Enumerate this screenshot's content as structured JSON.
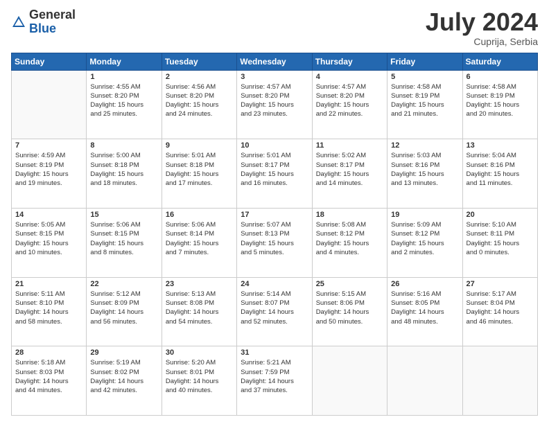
{
  "header": {
    "logo_general": "General",
    "logo_blue": "Blue",
    "month_year": "July 2024",
    "location": "Cuprija, Serbia"
  },
  "calendar": {
    "days_of_week": [
      "Sunday",
      "Monday",
      "Tuesday",
      "Wednesday",
      "Thursday",
      "Friday",
      "Saturday"
    ],
    "weeks": [
      [
        {
          "day": "",
          "info": ""
        },
        {
          "day": "1",
          "info": "Sunrise: 4:55 AM\nSunset: 8:20 PM\nDaylight: 15 hours\nand 25 minutes."
        },
        {
          "day": "2",
          "info": "Sunrise: 4:56 AM\nSunset: 8:20 PM\nDaylight: 15 hours\nand 24 minutes."
        },
        {
          "day": "3",
          "info": "Sunrise: 4:57 AM\nSunset: 8:20 PM\nDaylight: 15 hours\nand 23 minutes."
        },
        {
          "day": "4",
          "info": "Sunrise: 4:57 AM\nSunset: 8:20 PM\nDaylight: 15 hours\nand 22 minutes."
        },
        {
          "day": "5",
          "info": "Sunrise: 4:58 AM\nSunset: 8:19 PM\nDaylight: 15 hours\nand 21 minutes."
        },
        {
          "day": "6",
          "info": "Sunrise: 4:58 AM\nSunset: 8:19 PM\nDaylight: 15 hours\nand 20 minutes."
        }
      ],
      [
        {
          "day": "7",
          "info": "Sunrise: 4:59 AM\nSunset: 8:19 PM\nDaylight: 15 hours\nand 19 minutes."
        },
        {
          "day": "8",
          "info": "Sunrise: 5:00 AM\nSunset: 8:18 PM\nDaylight: 15 hours\nand 18 minutes."
        },
        {
          "day": "9",
          "info": "Sunrise: 5:01 AM\nSunset: 8:18 PM\nDaylight: 15 hours\nand 17 minutes."
        },
        {
          "day": "10",
          "info": "Sunrise: 5:01 AM\nSunset: 8:17 PM\nDaylight: 15 hours\nand 16 minutes."
        },
        {
          "day": "11",
          "info": "Sunrise: 5:02 AM\nSunset: 8:17 PM\nDaylight: 15 hours\nand 14 minutes."
        },
        {
          "day": "12",
          "info": "Sunrise: 5:03 AM\nSunset: 8:16 PM\nDaylight: 15 hours\nand 13 minutes."
        },
        {
          "day": "13",
          "info": "Sunrise: 5:04 AM\nSunset: 8:16 PM\nDaylight: 15 hours\nand 11 minutes."
        }
      ],
      [
        {
          "day": "14",
          "info": "Sunrise: 5:05 AM\nSunset: 8:15 PM\nDaylight: 15 hours\nand 10 minutes."
        },
        {
          "day": "15",
          "info": "Sunrise: 5:06 AM\nSunset: 8:15 PM\nDaylight: 15 hours\nand 8 minutes."
        },
        {
          "day": "16",
          "info": "Sunrise: 5:06 AM\nSunset: 8:14 PM\nDaylight: 15 hours\nand 7 minutes."
        },
        {
          "day": "17",
          "info": "Sunrise: 5:07 AM\nSunset: 8:13 PM\nDaylight: 15 hours\nand 5 minutes."
        },
        {
          "day": "18",
          "info": "Sunrise: 5:08 AM\nSunset: 8:12 PM\nDaylight: 15 hours\nand 4 minutes."
        },
        {
          "day": "19",
          "info": "Sunrise: 5:09 AM\nSunset: 8:12 PM\nDaylight: 15 hours\nand 2 minutes."
        },
        {
          "day": "20",
          "info": "Sunrise: 5:10 AM\nSunset: 8:11 PM\nDaylight: 15 hours\nand 0 minutes."
        }
      ],
      [
        {
          "day": "21",
          "info": "Sunrise: 5:11 AM\nSunset: 8:10 PM\nDaylight: 14 hours\nand 58 minutes."
        },
        {
          "day": "22",
          "info": "Sunrise: 5:12 AM\nSunset: 8:09 PM\nDaylight: 14 hours\nand 56 minutes."
        },
        {
          "day": "23",
          "info": "Sunrise: 5:13 AM\nSunset: 8:08 PM\nDaylight: 14 hours\nand 54 minutes."
        },
        {
          "day": "24",
          "info": "Sunrise: 5:14 AM\nSunset: 8:07 PM\nDaylight: 14 hours\nand 52 minutes."
        },
        {
          "day": "25",
          "info": "Sunrise: 5:15 AM\nSunset: 8:06 PM\nDaylight: 14 hours\nand 50 minutes."
        },
        {
          "day": "26",
          "info": "Sunrise: 5:16 AM\nSunset: 8:05 PM\nDaylight: 14 hours\nand 48 minutes."
        },
        {
          "day": "27",
          "info": "Sunrise: 5:17 AM\nSunset: 8:04 PM\nDaylight: 14 hours\nand 46 minutes."
        }
      ],
      [
        {
          "day": "28",
          "info": "Sunrise: 5:18 AM\nSunset: 8:03 PM\nDaylight: 14 hours\nand 44 minutes."
        },
        {
          "day": "29",
          "info": "Sunrise: 5:19 AM\nSunset: 8:02 PM\nDaylight: 14 hours\nand 42 minutes."
        },
        {
          "day": "30",
          "info": "Sunrise: 5:20 AM\nSunset: 8:01 PM\nDaylight: 14 hours\nand 40 minutes."
        },
        {
          "day": "31",
          "info": "Sunrise: 5:21 AM\nSunset: 7:59 PM\nDaylight: 14 hours\nand 37 minutes."
        },
        {
          "day": "",
          "info": ""
        },
        {
          "day": "",
          "info": ""
        },
        {
          "day": "",
          "info": ""
        }
      ]
    ]
  }
}
